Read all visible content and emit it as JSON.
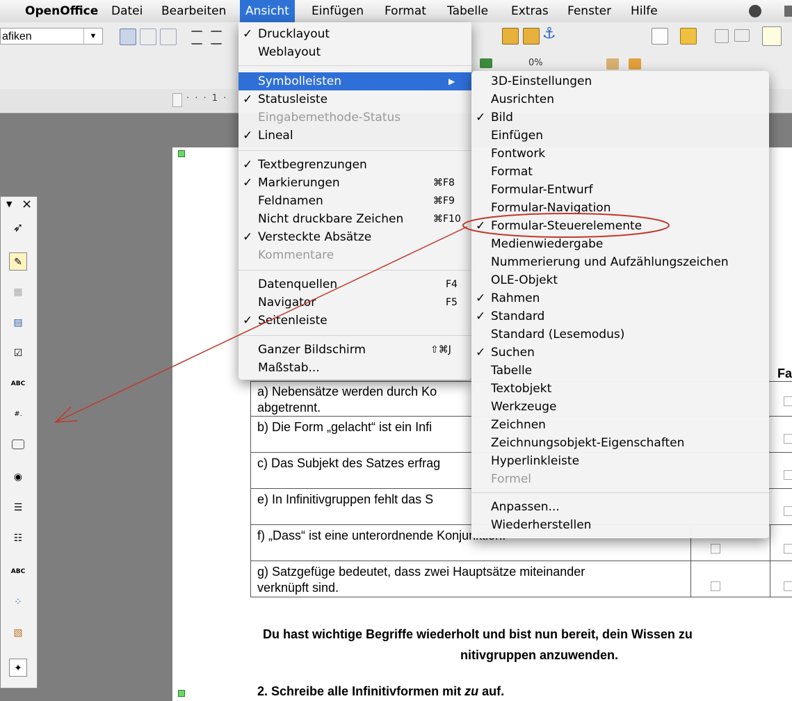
{
  "menubar": {
    "app_name": "OpenOffice",
    "items": [
      "Datei",
      "Bearbeiten",
      "Ansicht",
      "Einfügen",
      "Format",
      "Tabelle",
      "Extras",
      "Fenster",
      "Hilfe"
    ],
    "active": "Ansicht"
  },
  "toolbar": {
    "style_combo_value": "afiken",
    "ruler_mark": "1"
  },
  "ansicht_menu": {
    "items": [
      {
        "label": "Drucklayout",
        "checked": true
      },
      {
        "label": "Weblayout",
        "checked": false
      },
      {
        "label": "Symbolleisten",
        "submenu": true,
        "selected": true
      },
      {
        "label": "Statusleiste",
        "checked": true
      },
      {
        "label": "Eingabemethode-Status",
        "disabled": true
      },
      {
        "label": "Lineal",
        "checked": true
      },
      {
        "label": "Textbegrenzungen",
        "checked": true
      },
      {
        "label": "Markierungen",
        "checked": true,
        "shortcut": "⌘F8"
      },
      {
        "label": "Feldnamen",
        "shortcut": "⌘F9"
      },
      {
        "label": "Nicht druckbare Zeichen",
        "shortcut": "⌘F10"
      },
      {
        "label": "Versteckte Absätze",
        "checked": true
      },
      {
        "label": "Kommentare",
        "disabled": true
      },
      {
        "label": "Datenquellen",
        "shortcut": "F4"
      },
      {
        "label": "Navigator",
        "shortcut": "F5"
      },
      {
        "label": "Seitenleiste",
        "checked": true
      },
      {
        "label": "Ganzer Bildschirm",
        "shortcut": "⇧⌘J"
      },
      {
        "label": "Maßstab..."
      }
    ],
    "submenu_arrow": "▶",
    "check_glyph": "✓"
  },
  "symbolleisten_menu": {
    "items": [
      {
        "label": "3D-Einstellungen"
      },
      {
        "label": "Ausrichten"
      },
      {
        "label": "Bild",
        "checked": true
      },
      {
        "label": "Einfügen"
      },
      {
        "label": "Fontwork"
      },
      {
        "label": "Format"
      },
      {
        "label": "Formular-Entwurf"
      },
      {
        "label": "Formular-Navigation"
      },
      {
        "label": "Formular-Steuerelemente",
        "checked": true,
        "highlighted": true
      },
      {
        "label": "Medienwiedergabe"
      },
      {
        "label": "Nummerierung und Aufzählungszeichen"
      },
      {
        "label": "OLE-Objekt"
      },
      {
        "label": "Rahmen",
        "checked": true
      },
      {
        "label": "Standard",
        "checked": true
      },
      {
        "label": "Standard (Lesemodus)"
      },
      {
        "label": "Suchen",
        "checked": true
      },
      {
        "label": "Tabelle"
      },
      {
        "label": "Textobjekt"
      },
      {
        "label": "Werkzeuge"
      },
      {
        "label": "Zeichnen"
      },
      {
        "label": "Zeichnungsobjekt-Eigenschaften"
      },
      {
        "label": "Hyperlinkleiste"
      },
      {
        "label": "Formel",
        "disabled": true
      },
      {
        "label": "Anpassen..."
      },
      {
        "label": "Wiederherstellen"
      }
    ]
  },
  "document": {
    "header_col_fa": "Fa",
    "rows": [
      {
        "line1": "a) Nebensätze werden durch Ko",
        "line2": "abgetrennt."
      },
      {
        "line1": "b) Die Form „gelacht“ ist ein Infi",
        "line2": ""
      },
      {
        "line1": "c) Das Subjekt des Satzes erfrag",
        "line2": ""
      },
      {
        "line1": "e) In Infinitivgruppen fehlt das S",
        "line2": ""
      },
      {
        "line1": "f) „Dass“ ist eine unterordnende Konjunktion.",
        "line2": ""
      },
      {
        "line1": "g) Satzgefüge bedeutet, dass zwei Hauptsätze miteinander",
        "line2": "verknüpft sind."
      }
    ],
    "paragraph_line1": "Du hast wichtige Begriffe wiederholt und bist nun bereit, dein Wissen zu",
    "paragraph_line2": "nitivgruppen anzuwenden.",
    "task_prefix": "2. Schreibe alle Infinitivformen mit ",
    "task_italic": "zu",
    "task_suffix": " auf."
  },
  "formbar": {
    "menu_glyph": "▼",
    "close_glyph": "×",
    "abc_label": "ABC",
    "field_label": "#."
  },
  "colors": {
    "menu_highlight": "#2f6fd8",
    "annotation_red": "#c0392b"
  }
}
